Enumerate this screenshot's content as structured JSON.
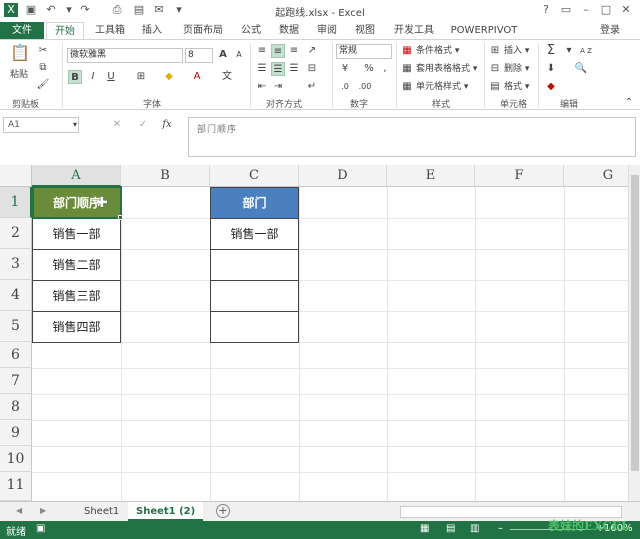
{
  "window": {
    "title": "起跑线.xlsx - Excel",
    "help": "?",
    "login": "登录"
  },
  "colors": {
    "excel_green": "#217346",
    "header_a_fill": "#6a8c3a",
    "header_c_fill": "#4a7fc0"
  },
  "tabs": [
    {
      "label": "文件"
    },
    {
      "label": "开始"
    },
    {
      "label": "工具箱"
    },
    {
      "label": "插入"
    },
    {
      "label": "页面布局"
    },
    {
      "label": "公式"
    },
    {
      "label": "数据"
    },
    {
      "label": "审阅"
    },
    {
      "label": "视图"
    },
    {
      "label": "开发工具"
    },
    {
      "label": "POWERPIVOT"
    }
  ],
  "ribbon": {
    "clipboard": {
      "paste": "粘贴",
      "label": "剪贴板"
    },
    "font": {
      "name": "微软雅黑",
      "size": "8",
      "bold": "B",
      "italic": "I",
      "underline": "U",
      "grow": "A",
      "shrink": "A",
      "label": "字体"
    },
    "alignment": {
      "label": "对齐方式"
    },
    "number": {
      "format": "常规",
      "percent": "%",
      "comma": ",",
      "label": "数字"
    },
    "styles": {
      "conditional": "条件格式 ▾",
      "table": "套用表格格式 ▾",
      "cell": "单元格样式 ▾",
      "label": "样式"
    },
    "cells": {
      "insert": "插入 ▾",
      "delete": "删除 ▾",
      "format": "格式 ▾",
      "label": "单元格"
    },
    "editing": {
      "sum": "Σ",
      "sort": "A Z",
      "find": "",
      "label": "编辑"
    }
  },
  "formula_bar": {
    "name_box": "A1",
    "fx": "fx",
    "content": "部门顺序"
  },
  "grid": {
    "columns": [
      "A",
      "B",
      "C",
      "D",
      "E",
      "F",
      "G"
    ],
    "rows": [
      "1",
      "2",
      "3",
      "4",
      "5",
      "6",
      "7",
      "8",
      "9",
      "10",
      "11"
    ],
    "col_a": [
      "部门顺序",
      "销售一部",
      "销售二部",
      "销售三部",
      "销售四部"
    ],
    "col_c": [
      "部门",
      "销售一部",
      "",
      "",
      ""
    ]
  },
  "sheets": [
    {
      "label": "Sheet1"
    },
    {
      "label": "Sheet1 (2)"
    }
  ],
  "status": {
    "ready": "就绪",
    "zoom": "160%",
    "watermark": "表妹的EXCEL"
  }
}
